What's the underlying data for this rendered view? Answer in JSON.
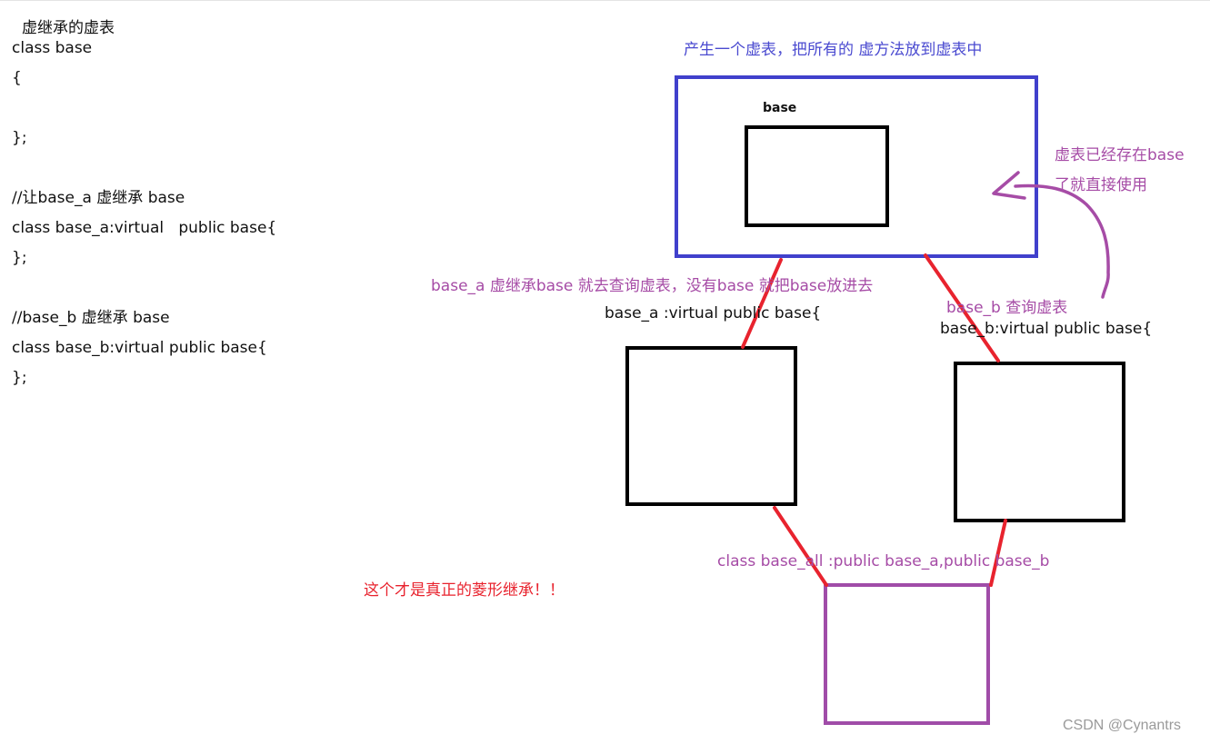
{
  "left_code": {
    "heading": "虚继承的虚表",
    "lines": [
      "class base",
      "{",
      "",
      "};",
      "",
      "//让base_a 虚继承 base",
      "class base_a:virtual   public base{",
      "};",
      "",
      "//base_b 虚继承 base",
      "class base_b:virtual public base{",
      "};"
    ]
  },
  "annotations": {
    "vtable_note": "产生一个虚表，把所有的 虚方法放到虚表中",
    "base_label": "base",
    "vtable_exists_line1": "虚表已经存在base",
    "vtable_exists_line2": "了就直接使用",
    "base_a_note": "base_a 虚继承base 就去查询虚表，没有base 就把base放进去",
    "base_a_decl": "base_a :virtual public base{",
    "base_b_note": "base_b 查询虚表",
    "base_b_decl": "base_b:virtual public base{",
    "base_all_decl": "class base_all :public base_a,public base_b",
    "diamond_note": "这个才是真正的菱形继承！！"
  },
  "watermark": "CSDN @Cynantrs",
  "colors": {
    "vtable_box": "#4040cc",
    "connector": "#e8232e",
    "arrow": "#a64ca6",
    "derived_box": "#a04ca8",
    "class_box": "#000000"
  }
}
